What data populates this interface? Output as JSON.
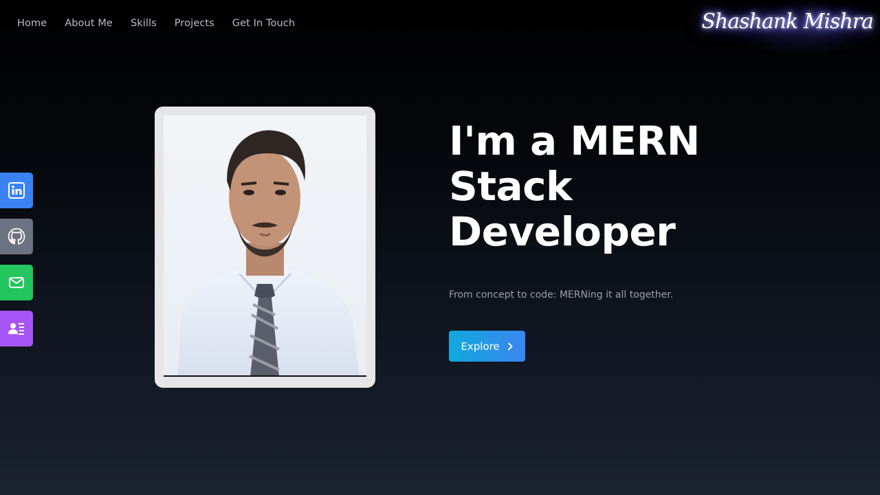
{
  "nav": {
    "items": [
      {
        "label": "Home"
      },
      {
        "label": "About Me"
      },
      {
        "label": "Skills"
      },
      {
        "label": "Projects"
      },
      {
        "label": "Get In Touch"
      }
    ]
  },
  "brand": {
    "name": "Shashank Mishra"
  },
  "social": [
    {
      "icon": "linkedin-icon",
      "color": "#3b82f6"
    },
    {
      "icon": "github-icon",
      "color": "#6b7280"
    },
    {
      "icon": "mail-icon",
      "color": "#22c55e"
    },
    {
      "icon": "contact-card-icon",
      "color": "#a855f7"
    }
  ],
  "hero": {
    "title_line1": "I'm a MERN",
    "title_line2": "Stack",
    "title_line3": "Developer",
    "subtitle": "From concept to code: MERNing it all together.",
    "cta_label": "Explore"
  },
  "colors": {
    "cta_gradient_start": "#10a9dd",
    "cta_gradient_end": "#3a86f0",
    "brand_glow": "#8a84ff"
  }
}
